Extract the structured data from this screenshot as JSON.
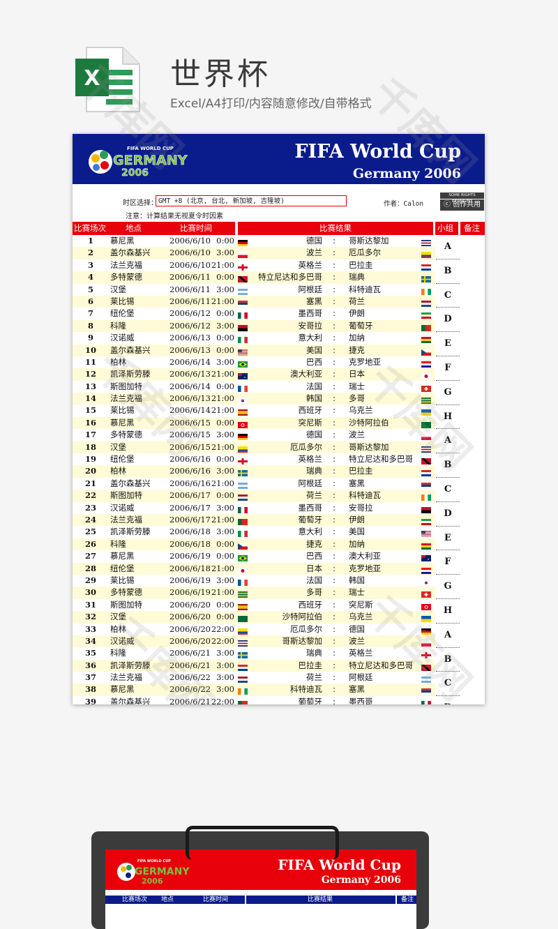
{
  "header": {
    "title": "世界杯",
    "subtitle": "Excel/A4打印/内容随意修改/自带格式",
    "icon_letter": "X"
  },
  "banner": {
    "title": "FIFA World Cup",
    "subtitle": "Germany 2006",
    "logo_top": "FIFA WORLD CUP",
    "logo_main": "GERMANY",
    "logo_year": "2006"
  },
  "meta": {
    "tz_label": "时区选择：",
    "tz_value": "GMT +8 (北京, 台北, 新加坡, 吉隆坡)",
    "note": "注意：计算结果无视夏令时因素",
    "author": "作者：Calon",
    "cc_top": "SOME RIGHTS RESERVED",
    "cc_text": "创作共用"
  },
  "columns": {
    "match": "比赛场次",
    "venue": "地点",
    "time": "比赛时间",
    "result": "比赛结果",
    "group": "小组",
    "remark": "备注"
  },
  "colors": {
    "banner": "#0a1c8c",
    "header": "#e8000a",
    "stripe": "#fffbd7"
  },
  "matches": [
    {
      "no": "1",
      "venue": "慕尼黑",
      "date": "2006/6/10",
      "time": "0:00",
      "home": "德国",
      "away": "哥斯达黎加",
      "f1": "de",
      "f2": "cr"
    },
    {
      "no": "2",
      "venue": "盖尔森基兴",
      "date": "2006/6/10",
      "time": "3:00",
      "home": "波兰",
      "away": "厄瓜多尔",
      "f1": "pl",
      "f2": "ec"
    },
    {
      "no": "3",
      "venue": "法兰克福",
      "date": "2006/6/10",
      "time": "21:00",
      "home": "英格兰",
      "away": "巴拉圭",
      "f1": "en",
      "f2": "py"
    },
    {
      "no": "4",
      "venue": "多特蒙德",
      "date": "2006/6/11",
      "time": "0:00",
      "home": "特立尼达和多巴哥",
      "away": "瑞典",
      "f1": "tt",
      "f2": "se"
    },
    {
      "no": "5",
      "venue": "汉堡",
      "date": "2006/6/11",
      "time": "3:00",
      "home": "阿根廷",
      "away": "科特迪瓦",
      "f1": "ar",
      "f2": "ci"
    },
    {
      "no": "6",
      "venue": "莱比锡",
      "date": "2006/6/11",
      "time": "21:00",
      "home": "塞黑",
      "away": "荷兰",
      "f1": "cs",
      "f2": "nl"
    },
    {
      "no": "7",
      "venue": "纽伦堡",
      "date": "2006/6/12",
      "time": "0:00",
      "home": "墨西哥",
      "away": "伊朗",
      "f1": "mx",
      "f2": "ir"
    },
    {
      "no": "8",
      "venue": "科隆",
      "date": "2006/6/12",
      "time": "3:00",
      "home": "安哥拉",
      "away": "葡萄牙",
      "f1": "ao",
      "f2": "pt"
    },
    {
      "no": "9",
      "venue": "汉诺威",
      "date": "2006/6/13",
      "time": "0:00",
      "home": "意大利",
      "away": "加纳",
      "f1": "it",
      "f2": "gh"
    },
    {
      "no": "10",
      "venue": "盖尔森基兴",
      "date": "2006/6/13",
      "time": "0:00",
      "home": "美国",
      "away": "捷克",
      "f1": "us",
      "f2": "cz"
    },
    {
      "no": "11",
      "venue": "柏林",
      "date": "2006/6/14",
      "time": "3:00",
      "home": "巴西",
      "away": "克罗地亚",
      "f1": "br",
      "f2": "hr"
    },
    {
      "no": "12",
      "venue": "凯泽斯劳滕",
      "date": "2006/6/13",
      "time": "21:00",
      "home": "澳大利亚",
      "away": "日本",
      "f1": "au",
      "f2": "jp"
    },
    {
      "no": "13",
      "venue": "斯图加特",
      "date": "2006/6/14",
      "time": "0:00",
      "home": "法国",
      "away": "瑞士",
      "f1": "fr",
      "f2": "ch"
    },
    {
      "no": "14",
      "venue": "法兰克福",
      "date": "2006/6/13",
      "time": "21:00",
      "home": "韩国",
      "away": "多哥",
      "f1": "kr",
      "f2": "tg"
    },
    {
      "no": "15",
      "venue": "莱比锡",
      "date": "2006/6/14",
      "time": "21:00",
      "home": "西班牙",
      "away": "乌克兰",
      "f1": "es",
      "f2": "ua"
    },
    {
      "no": "16",
      "venue": "慕尼黑",
      "date": "2006/6/15",
      "time": "0:00",
      "home": "突尼斯",
      "away": "沙特阿拉伯",
      "f1": "tn",
      "f2": "sa"
    },
    {
      "no": "17",
      "venue": "多特蒙德",
      "date": "2006/6/15",
      "time": "3:00",
      "home": "德国",
      "away": "波兰",
      "f1": "de",
      "f2": "pl"
    },
    {
      "no": "18",
      "venue": "汉堡",
      "date": "2006/6/15",
      "time": "21:00",
      "home": "厄瓜多尔",
      "away": "哥斯达黎加",
      "f1": "ec",
      "f2": "cr"
    },
    {
      "no": "19",
      "venue": "纽伦堡",
      "date": "2006/6/16",
      "time": "0:00",
      "home": "英格兰",
      "away": "特立尼达和多巴哥",
      "f1": "en",
      "f2": "tt"
    },
    {
      "no": "20",
      "venue": "柏林",
      "date": "2006/6/16",
      "time": "3:00",
      "home": "瑞典",
      "away": "巴拉圭",
      "f1": "se",
      "f2": "py"
    },
    {
      "no": "21",
      "venue": "盖尔森基兴",
      "date": "2006/6/16",
      "time": "21:00",
      "home": "阿根廷",
      "away": "塞黑",
      "f1": "ar",
      "f2": "cs"
    },
    {
      "no": "22",
      "venue": "斯图加特",
      "date": "2006/6/17",
      "time": "0:00",
      "home": "荷兰",
      "away": "科特迪瓦",
      "f1": "nl",
      "f2": "ci"
    },
    {
      "no": "23",
      "venue": "汉诺威",
      "date": "2006/6/17",
      "time": "3:00",
      "home": "墨西哥",
      "away": "安哥拉",
      "f1": "mx",
      "f2": "ao"
    },
    {
      "no": "24",
      "venue": "法兰克福",
      "date": "2006/6/17",
      "time": "21:00",
      "home": "葡萄牙",
      "away": "伊朗",
      "f1": "pt",
      "f2": "ir"
    },
    {
      "no": "25",
      "venue": "凯泽斯劳滕",
      "date": "2006/6/18",
      "time": "3:00",
      "home": "意大利",
      "away": "美国",
      "f1": "it",
      "f2": "us"
    },
    {
      "no": "26",
      "venue": "科隆",
      "date": "2006/6/18",
      "time": "0:00",
      "home": "捷克",
      "away": "加纳",
      "f1": "cz",
      "f2": "gh"
    },
    {
      "no": "27",
      "venue": "慕尼黑",
      "date": "2006/6/19",
      "time": "0:00",
      "home": "巴西",
      "away": "澳大利亚",
      "f1": "br",
      "f2": "au"
    },
    {
      "no": "28",
      "venue": "纽伦堡",
      "date": "2006/6/18",
      "time": "21:00",
      "home": "日本",
      "away": "克罗地亚",
      "f1": "jp",
      "f2": "hr"
    },
    {
      "no": "29",
      "venue": "莱比锡",
      "date": "2006/6/19",
      "time": "3:00",
      "home": "法国",
      "away": "韩国",
      "f1": "fr",
      "f2": "kr"
    },
    {
      "no": "30",
      "venue": "多特蒙德",
      "date": "2006/6/19",
      "time": "21:00",
      "home": "多哥",
      "away": "瑞士",
      "f1": "tg",
      "f2": "ch"
    },
    {
      "no": "31",
      "venue": "斯图加特",
      "date": "2006/6/20",
      "time": "0:00",
      "home": "西班牙",
      "away": "突尼斯",
      "f1": "es",
      "f2": "tn"
    },
    {
      "no": "32",
      "venue": "汉堡",
      "date": "2006/6/20",
      "time": "0:00",
      "home": "沙特阿拉伯",
      "away": "乌克兰",
      "f1": "sa",
      "f2": "ua"
    },
    {
      "no": "33",
      "venue": "柏林",
      "date": "2006/6/20",
      "time": "22:00",
      "home": "厄瓜多尔",
      "away": "德国",
      "f1": "ec",
      "f2": "de"
    },
    {
      "no": "34",
      "venue": "汉诺威",
      "date": "2006/6/20",
      "time": "22:00",
      "home": "哥斯达黎加",
      "away": "波兰",
      "f1": "cr",
      "f2": "pl"
    },
    {
      "no": "35",
      "venue": "科隆",
      "date": "2006/6/21",
      "time": "3:00",
      "home": "瑞典",
      "away": "英格兰",
      "f1": "se",
      "f2": "en"
    },
    {
      "no": "36",
      "venue": "凯泽斯劳滕",
      "date": "2006/6/21",
      "time": "3:00",
      "home": "巴拉圭",
      "away": "特立尼达和多巴哥",
      "f1": "py",
      "f2": "tt"
    },
    {
      "no": "37",
      "venue": "法兰克福",
      "date": "2006/6/22",
      "time": "3:00",
      "home": "荷兰",
      "away": "阿根廷",
      "f1": "nl",
      "f2": "ar"
    },
    {
      "no": "38",
      "venue": "慕尼黑",
      "date": "2006/6/22",
      "time": "3:00",
      "home": "科特迪瓦",
      "away": "塞黑",
      "f1": "ci",
      "f2": "cs"
    },
    {
      "no": "39",
      "venue": "盖尔森基兴",
      "date": "2006/6/21",
      "time": "22:00",
      "home": "葡萄牙",
      "away": "墨西哥",
      "f1": "pt",
      "f2": "mx"
    }
  ],
  "groups": [
    "A",
    "B",
    "C",
    "D",
    "E",
    "F",
    "G",
    "H",
    "A",
    "B",
    "C",
    "D",
    "E",
    "F",
    "G",
    "H",
    "A",
    "B",
    "C",
    "D"
  ],
  "watermark": "千库网",
  "preview": {
    "title": "FIFA World Cup",
    "subtitle": "Germany 2006",
    "cols": [
      "比赛场次",
      "地点",
      "比赛时间",
      "比赛结果",
      "备注"
    ]
  }
}
